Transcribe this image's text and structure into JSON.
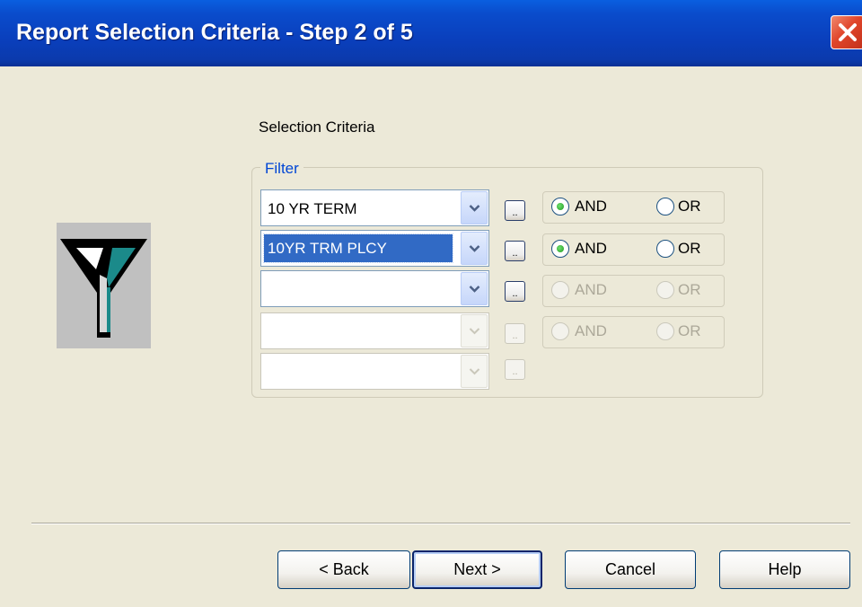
{
  "window": {
    "title": "Report Selection Criteria - Step 2 of 5"
  },
  "icons": {
    "close": "close-icon",
    "funnel": "filter-funnel-icon",
    "dropdown": "chevron-down-icon"
  },
  "section_title": "Selection Criteria",
  "filter_group": {
    "legend": "Filter",
    "rows": [
      {
        "value": "10 YR TERM",
        "selected": false,
        "enabled": true,
        "logic": {
          "and_label": "AND",
          "or_label": "OR",
          "and_checked": true,
          "enabled": true
        }
      },
      {
        "value": "10YR TRM PLCY",
        "selected": true,
        "enabled": true,
        "logic": {
          "and_label": "AND",
          "or_label": "OR",
          "and_checked": true,
          "enabled": true
        }
      },
      {
        "value": "",
        "selected": false,
        "enabled": true,
        "logic": {
          "and_label": "AND",
          "or_label": "OR",
          "and_checked": false,
          "enabled": false
        }
      },
      {
        "value": "",
        "selected": false,
        "enabled": false,
        "logic": {
          "and_label": "AND",
          "or_label": "OR",
          "and_checked": false,
          "enabled": false
        }
      },
      {
        "value": "",
        "selected": false,
        "enabled": false
      }
    ],
    "ellipsis_label": ".."
  },
  "buttons": {
    "back": "< Back",
    "next": "Next >",
    "cancel": "Cancel",
    "help": "Help"
  },
  "colors": {
    "titlebar": "#0a3fbc",
    "background": "#ECE9D8",
    "selection": "#316ac5",
    "legend": "#0046d5"
  }
}
